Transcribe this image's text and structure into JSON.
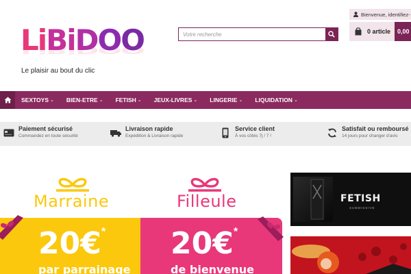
{
  "brand": {
    "logo_letters": [
      "L",
      "i",
      "B",
      "i",
      "D",
      "O",
      "O"
    ],
    "tagline": "Le plaisir au bout du clic",
    "colors": {
      "primary": "#8b2a5f",
      "pink": "#e8387a",
      "yellow": "#fbc80d",
      "purple": "#7a2ba3"
    }
  },
  "search": {
    "placeholder": "Votre recherche",
    "value": "",
    "button_icon": "search-icon"
  },
  "account": {
    "label": "Bienvenue, identifiez-",
    "icon": "user-icon"
  },
  "cart": {
    "label": "0 article",
    "total": "0,00",
    "icon": "shopping-bag-icon"
  },
  "nav": {
    "home_icon": "home-icon",
    "items": [
      {
        "label": "SEXTOYS"
      },
      {
        "label": "BIEN-ETRE"
      },
      {
        "label": "FETISH"
      },
      {
        "label": "JEUX-LIVRES"
      },
      {
        "label": "LINGERIE"
      },
      {
        "label": "LIQUIDATION"
      }
    ]
  },
  "reassurance": [
    {
      "title": "Paiement sécurisé",
      "subtitle": "Commandez en toute sécurité",
      "icon": "credit-card-icon"
    },
    {
      "title": "Livraison rapide",
      "subtitle": "Expédition & Livraison rapide",
      "icon": "truck-icon"
    },
    {
      "title": "Service client",
      "subtitle": "À vos côtés 7j / 7 !",
      "icon": "phone-icon"
    },
    {
      "title": "Satisfait ou remboursé",
      "subtitle": "14 jours pour changer d'avis",
      "icon": "refresh-icon"
    }
  ],
  "promo": {
    "left": {
      "label": "Marraine",
      "amount": "20€",
      "star": "*",
      "subtitle": "par parrainage"
    },
    "right": {
      "label": "Filleule",
      "amount": "20€",
      "star": "*",
      "subtitle": "de bienvenue"
    }
  },
  "banners": {
    "fetish": {
      "title": "FETISH",
      "subtitle": "SUBMISSIVE"
    }
  }
}
